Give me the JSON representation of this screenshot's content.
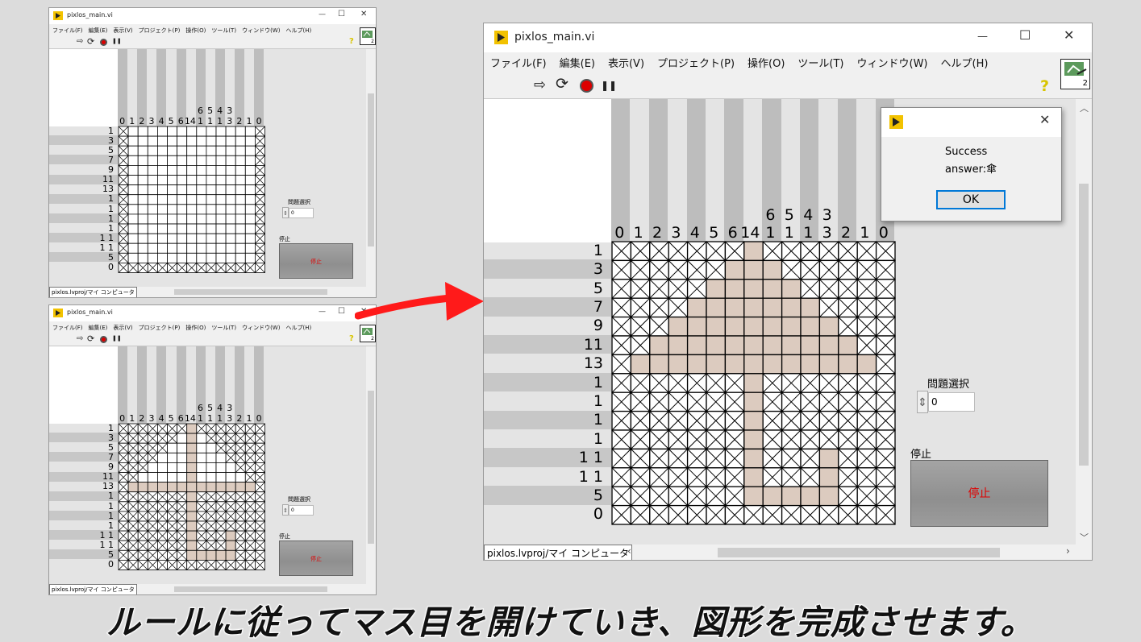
{
  "window": {
    "title": "pixlos_main.vi",
    "buttons": {
      "minimize": "—",
      "maximize": "☐",
      "close": "✕"
    },
    "menu": [
      "ファイル(F)",
      "編集(E)",
      "表示(V)",
      "プロジェクト(P)",
      "操作(O)",
      "ツール(T)",
      "ウィンドウ(W)",
      "ヘルプ(H)"
    ],
    "toolbar": {
      "run": "⇨",
      "run_continuous": "⟳",
      "pause": "❚❚",
      "help": "?"
    },
    "vi_icon_number": "2"
  },
  "puzzle": {
    "column_hints_top": [
      "",
      "",
      "",
      "",
      "",
      "",
      "",
      "6",
      "5",
      "4",
      "3",
      "",
      "",
      ""
    ],
    "column_hints_bottom": [
      "0",
      "1",
      "2",
      "3",
      "4",
      "5",
      "6",
      "14",
      "1",
      "1",
      "1",
      "3",
      "2",
      "1",
      "0"
    ],
    "row_hints": [
      "1",
      "3",
      "5",
      "7",
      "9",
      "11",
      "13",
      "1",
      "1",
      "1",
      "1",
      "1 1",
      "1 1",
      "5",
      "0"
    ],
    "open_color": "#dccbbf",
    "grid_color": "#000000"
  },
  "screens": [
    {
      "grid_state": "start",
      "select_label": "問題選択",
      "select_value": "0",
      "stop_label": "停止",
      "stop_button": "停止"
    },
    {
      "grid_state": "partial",
      "select_label": "問題選択",
      "select_value": "0",
      "stop_label": "停止",
      "stop_button": "停止"
    },
    {
      "grid_state": "solved",
      "select_label": "問題選択",
      "select_value": "0",
      "stop_label": "停止",
      "stop_button": "停止"
    }
  ],
  "status_path": "pixlos.lvproj/マイ コンピュータ",
  "dialog": {
    "message": "Success",
    "answer": "answer:傘",
    "ok": "OK"
  },
  "accent_color": "#ff1a1a",
  "caption": "ルールに従ってマス目を開けていき、図形を完成させます。"
}
